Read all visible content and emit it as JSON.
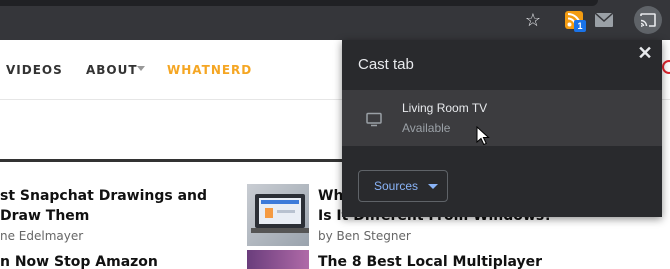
{
  "toolbar": {
    "icons": [
      "star-icon",
      "rss-extension-icon",
      "mail-extension-icon",
      "cast-icon"
    ],
    "rss_badge": "1",
    "accent_color": "#1a73e8"
  },
  "site_nav": {
    "items": [
      {
        "label": "VIDEOS"
      },
      {
        "label": "ABOUT"
      },
      {
        "label": "WHATNERD"
      }
    ],
    "highlight_color": "#f5a623"
  },
  "articles": [
    {
      "title": "st Snapchat Drawings and",
      "title2": "Draw Them",
      "byline": "ne Edelmayer"
    },
    {
      "title": "n Now Stop Amazon"
    },
    {
      "title": "Wh",
      "title2": "Is It Different From Windows?",
      "byline": "by Ben Stegner"
    },
    {
      "title": "The 8 Best Local Multiplayer"
    }
  ],
  "cast_popup": {
    "title": "Cast tab",
    "close_glyph": "✕",
    "sinks": [
      {
        "name": "Living Room TV",
        "status": "Available",
        "icon": "tv-icon"
      }
    ],
    "sources_label": "Sources",
    "link_color": "#8ab4f8"
  }
}
